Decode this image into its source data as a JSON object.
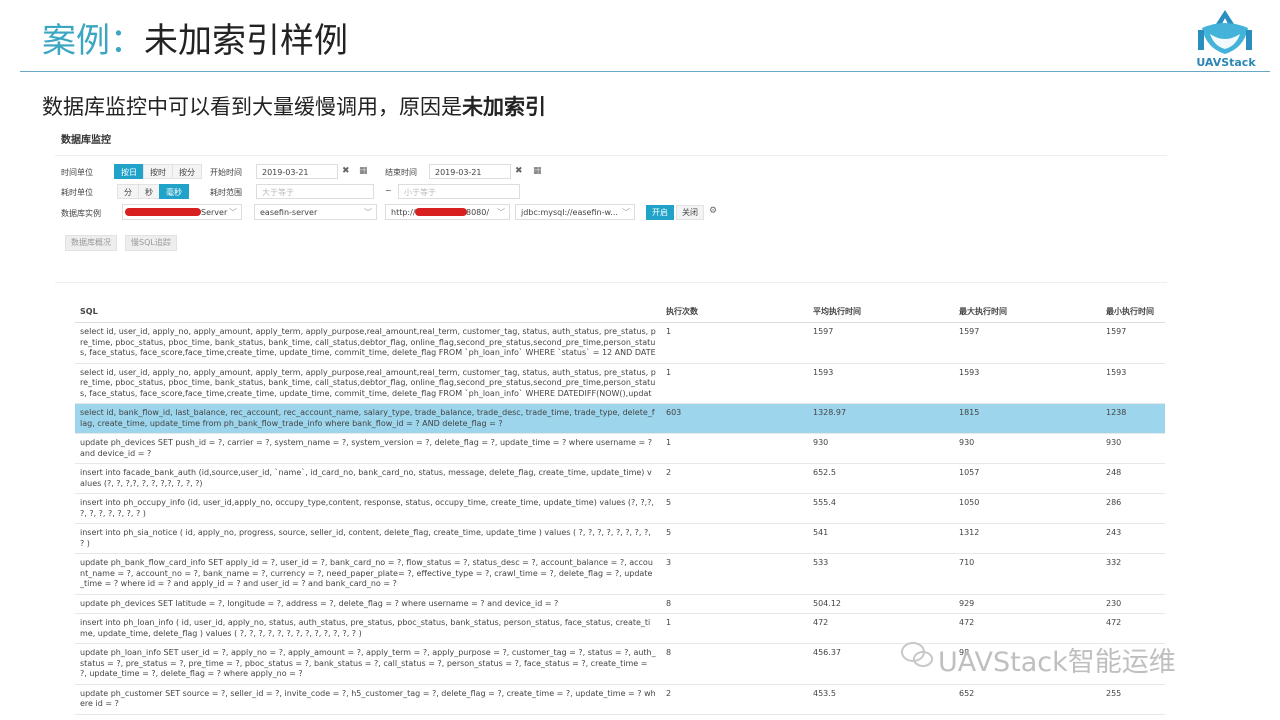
{
  "slide": {
    "title_case": "案例：",
    "title_main": "未加索引样例",
    "subtitle_lead": "数据库监控中可以看到大量缓慢调用，原因是",
    "subtitle_bold": "未加索引",
    "logo_text": "UAVStack",
    "watermark": "UAVStack智能运维"
  },
  "panel": {
    "title": "数据库监控",
    "time_unit_label": "时间单位",
    "time_unit_options": [
      "按日",
      "按时",
      "按分"
    ],
    "start_label": "开始时间",
    "start_value": "2019-03-21",
    "end_label": "结束时间",
    "end_value": "2019-03-21",
    "duration_unit_label": "耗时单位",
    "duration_unit_options": [
      "分",
      "秒",
      "毫秒"
    ],
    "duration_range_label": "耗时范围",
    "min_placeholder": "大于等于",
    "range_sep": "~",
    "max_placeholder": "小于等于",
    "instance_label": "数据库实例",
    "server_suffix": "Server",
    "app_value": "easefin-server",
    "url_prefix": "http://",
    "url_suffix": "8080/",
    "jdbc_value": "jdbc:mysql://easefin-w...",
    "btn_open": "开启",
    "btn_close": "关闭",
    "tab_overview": "数据库概况",
    "tab_slow": "慢SQL追踪"
  },
  "table": {
    "headers": [
      "SQL",
      "执行次数",
      "平均执行时间",
      "最大执行时间",
      "最小执行时间"
    ],
    "rows": [
      {
        "sql": "select id, user_id, apply_no, apply_amount, apply_term, apply_purpose,real_amount,real_term, customer_tag, status, auth_status, pre_status, pre_time, pboc_status, pboc_time, bank_status, bank_time, call_status,debtor_flag, online_flag,second_pre_status,second_pre_time,person_status, face_status, face_score,face_time,create_time, update_time, commit_time, delete_flag FROM `ph_loan_info` WHERE `status` = 12 AND DATEDIF",
        "count": "1",
        "avg": "1597",
        "max": "1597",
        "min": "1597"
      },
      {
        "sql": "select id, user_id, apply_no, apply_amount, apply_term, apply_purpose,real_amount,real_term, customer_tag, status, auth_status, pre_status, pre_time, pboc_status, pboc_time, bank_status, bank_time, call_status,debtor_flag, online_flag,second_pre_status,second_pre_time,person_status, face_status, face_score,face_time,create_time, update_time, commit_time, delete_flag FROM `ph_loan_info` WHERE DATEDIFF(NOW(),update_ti",
        "count": "1",
        "avg": "1593",
        "max": "1593",
        "min": "1593"
      },
      {
        "sql": "select id, bank_flow_id, last_balance, rec_account, rec_account_name, salary_type, trade_balance, trade_desc, trade_time, trade_type, delete_flag, create_time, update_time from ph_bank_flow_trade_info where bank_flow_id = ? AND delete_flag = ?",
        "count": "603",
        "avg": "1328.97",
        "max": "1815",
        "min": "1238",
        "highlight": true
      },
      {
        "sql": "update ph_devices SET push_id = ?, carrier = ?, system_name = ?, system_version = ?, delete_flag = ?, update_time = ? where username = ? and device_id = ?",
        "count": "1",
        "avg": "930",
        "max": "930",
        "min": "930"
      },
      {
        "sql": "insert into facade_bank_auth (id,source,user_id, `name`, id_card_no, bank_card_no, status, message, delete_flag, create_time, update_time) values (?, ?, ?,?, ?, ?, ?,?, ?, ?, ?)",
        "count": "2",
        "avg": "652.5",
        "max": "1057",
        "min": "248"
      },
      {
        "sql": "insert into ph_occupy_info (id, user_id,apply_no, occupy_type,content, response, status, occupy_time, create_time, update_time) values (?, ?,?, ?, ?, ?, ?, ?, ?, ? )",
        "count": "5",
        "avg": "555.4",
        "max": "1050",
        "min": "286"
      },
      {
        "sql": "insert into ph_sia_notice ( id, apply_no, progress, source, seller_id, content, delete_flag, create_time, update_time ) values ( ?, ?, ?, ?, ?, ?, ?, ?, ? )",
        "count": "5",
        "avg": "541",
        "max": "1312",
        "min": "243"
      },
      {
        "sql": "update ph_bank_flow_card_info SET apply_id = ?, user_id = ?, bank_card_no = ?, flow_status = ?, status_desc = ?, account_balance = ?, account_name = ?, account_no = ?, bank_name = ?, currency = ?, need_paper_plate= ?, effective_type = ?, crawl_time = ?, delete_flag = ?, update_time = ? where id = ? and apply_id = ? and user_id = ? and bank_card_no = ?",
        "count": "3",
        "avg": "533",
        "max": "710",
        "min": "332"
      },
      {
        "sql": "update ph_devices SET latitude = ?, longitude = ?, address = ?, delete_flag = ? where username = ? and device_id = ?",
        "count": "8",
        "avg": "504.12",
        "max": "929",
        "min": "230"
      },
      {
        "sql": "insert into ph_loan_info ( id, user_id, apply_no, status, auth_status, pre_status, pboc_status, bank_status, person_status, face_status, create_time, update_time, delete_flag ) values ( ?, ?, ?, ?, ?, ?, ?, ?, ?, ?, ?, ?, ? )",
        "count": "1",
        "avg": "472",
        "max": "472",
        "min": "472"
      },
      {
        "sql": "update ph_loan_info SET user_id = ?, apply_no = ?, apply_amount = ?, apply_term = ?, apply_purpose = ?, customer_tag = ?, status = ?, auth_status = ?, pre_status = ?, pre_time = ?, pboc_status = ?, bank_status = ?, call_status = ?, person_status = ?, face_status = ?, create_time = ?, update_time = ?, delete_flag = ? where apply_no = ?",
        "count": "8",
        "avg": "456.37",
        "max": "98",
        "min": ""
      },
      {
        "sql": "update ph_customer SET source = ?, seller_id = ?, invite_code = ?, h5_customer_tag = ?, delete_flag = ?, create_time = ?, update_time = ? where id = ?",
        "count": "2",
        "avg": "453.5",
        "max": "652",
        "min": "255"
      }
    ]
  }
}
